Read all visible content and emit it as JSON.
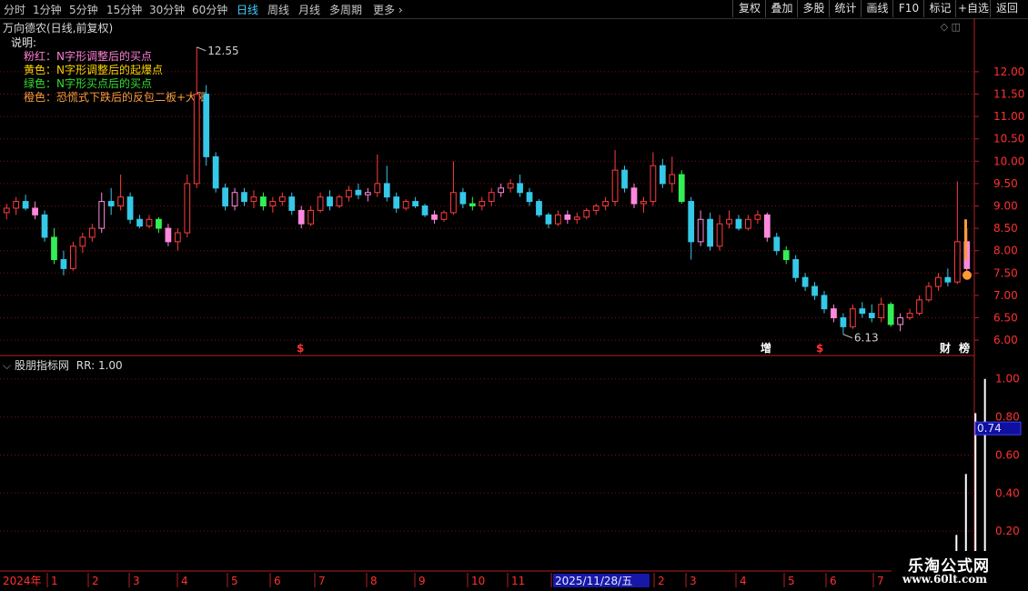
{
  "toolbar": {
    "periods": [
      "分时",
      "1分钟",
      "5分钟",
      "15分钟",
      "30分钟",
      "60分钟",
      "日线",
      "周线",
      "月线",
      "多周期",
      "更多"
    ],
    "active_period": "日线",
    "more_arrow": "›",
    "right_buttons": [
      "复权",
      "叠加",
      "多股",
      "统计",
      "画线",
      "F10",
      "标记",
      "+自选",
      "返回"
    ]
  },
  "stock": {
    "title": "万向德农(日线,前复权)"
  },
  "legend": {
    "title": "说明:",
    "lines": [
      {
        "text": "粉红：N字形调整后的买点",
        "color": "#ff7fd4"
      },
      {
        "text": "黄色：N字形调整后的起爆点",
        "color": "#ffd700"
      },
      {
        "text": "绿色：N字形买点后的买点",
        "color": "#33dd33"
      },
      {
        "text": "橙色：恐慌式下跌后的反包二板+大阳",
        "color": "#ffa040"
      }
    ]
  },
  "price_axis": {
    "ticks": [
      "12.00",
      "11.50",
      "11.00",
      "10.50",
      "10.00",
      "9.50",
      "9.00",
      "8.50",
      "8.00",
      "7.50",
      "7.00",
      "6.50",
      "6.00"
    ],
    "ymin": 5.88,
    "ymax": 12.75
  },
  "annotations": {
    "high": "12.55",
    "low": "6.13",
    "event_markers": [
      {
        "text": "$",
        "color": "#ff3333"
      },
      {
        "text": "增",
        "color": "#ffffff"
      },
      {
        "text": "$",
        "color": "#ff3333"
      },
      {
        "text": "财",
        "color": "#ffffff"
      },
      {
        "text": "榜",
        "color": "#ffffff"
      }
    ]
  },
  "indicator": {
    "name": "股朋指标网",
    "param": "RR: 1.00",
    "ticks": [
      "1.00",
      "0.80",
      "0.60",
      "0.40",
      "0.20"
    ],
    "current_value": "0.74",
    "ymin": 0.0,
    "ymax": 1.08
  },
  "time_axis": {
    "labels": [
      "2024年",
      "1",
      "2",
      "3",
      "4",
      "5",
      "6",
      "7",
      "8",
      "9",
      "10",
      "11",
      "2025/11/28/五",
      "2",
      "3",
      "4",
      "5",
      "6",
      "7"
    ],
    "highlight": "2025/11/28/五"
  },
  "watermark": {
    "line1": "乐淘公式网",
    "line2": "www.60lt.com"
  },
  "chart_data": {
    "type": "candlestick",
    "series": [
      {
        "values": [
          [
            8.85,
            9.05,
            8.7,
            8.95
          ],
          [
            8.95,
            9.2,
            8.8,
            9.1
          ],
          [
            9.1,
            9.25,
            8.9,
            8.95
          ],
          [
            8.95,
            9.1,
            8.7,
            8.8
          ],
          [
            8.8,
            8.9,
            8.2,
            8.3
          ],
          [
            8.3,
            8.5,
            7.7,
            7.8
          ],
          [
            7.8,
            8.0,
            7.45,
            7.6
          ],
          [
            7.6,
            8.2,
            7.55,
            8.1
          ],
          [
            8.1,
            8.4,
            7.95,
            8.3
          ],
          [
            8.3,
            8.6,
            8.2,
            8.5
          ],
          [
            8.5,
            9.3,
            8.4,
            9.1
          ],
          [
            9.1,
            9.4,
            8.8,
            9.0
          ],
          [
            9.0,
            9.7,
            8.9,
            9.2
          ],
          [
            9.2,
            9.3,
            8.6,
            8.7
          ],
          [
            8.7,
            8.8,
            8.5,
            8.55
          ],
          [
            8.55,
            8.8,
            8.5,
            8.7
          ],
          [
            8.7,
            8.75,
            8.4,
            8.5
          ],
          [
            8.5,
            8.6,
            8.1,
            8.2
          ],
          [
            8.2,
            8.5,
            8.0,
            8.4
          ],
          [
            8.4,
            9.7,
            8.3,
            9.5
          ],
          [
            9.5,
            12.55,
            9.4,
            11.5
          ],
          [
            11.5,
            11.7,
            9.9,
            10.1
          ],
          [
            10.1,
            10.2,
            9.3,
            9.4
          ],
          [
            9.4,
            9.5,
            8.9,
            9.0
          ],
          [
            9.0,
            9.4,
            8.9,
            9.3
          ],
          [
            9.3,
            9.4,
            9.0,
            9.1
          ],
          [
            9.1,
            9.35,
            8.95,
            9.2
          ],
          [
            9.2,
            9.3,
            8.9,
            9.0
          ],
          [
            9.0,
            9.2,
            8.85,
            9.1
          ],
          [
            9.1,
            9.3,
            9.0,
            9.2
          ],
          [
            9.2,
            9.3,
            8.8,
            8.9
          ],
          [
            8.9,
            9.0,
            8.5,
            8.6
          ],
          [
            8.6,
            9.0,
            8.55,
            8.9
          ],
          [
            8.9,
            9.3,
            8.85,
            9.2
          ],
          [
            9.2,
            9.35,
            8.9,
            9.0
          ],
          [
            9.0,
            9.25,
            8.95,
            9.2
          ],
          [
            9.2,
            9.45,
            9.1,
            9.35
          ],
          [
            9.35,
            9.5,
            9.15,
            9.25
          ],
          [
            9.25,
            9.4,
            9.1,
            9.3
          ],
          [
            9.3,
            10.15,
            9.2,
            9.5
          ],
          [
            9.5,
            9.9,
            9.1,
            9.2
          ],
          [
            9.2,
            9.3,
            8.85,
            8.95
          ],
          [
            8.95,
            9.15,
            8.9,
            9.1
          ],
          [
            9.1,
            9.2,
            8.95,
            9.0
          ],
          [
            9.0,
            9.05,
            8.75,
            8.8
          ],
          [
            8.8,
            8.9,
            8.6,
            8.7
          ],
          [
            8.7,
            8.9,
            8.65,
            8.85
          ],
          [
            8.85,
            10.0,
            8.8,
            9.3
          ],
          [
            9.3,
            9.4,
            8.95,
            9.05
          ],
          [
            9.05,
            9.2,
            8.9,
            9.0
          ],
          [
            9.0,
            9.2,
            8.9,
            9.1
          ],
          [
            9.1,
            9.4,
            9.0,
            9.3
          ],
          [
            9.3,
            9.5,
            9.2,
            9.4
          ],
          [
            9.4,
            9.6,
            9.3,
            9.5
          ],
          [
            9.5,
            9.7,
            9.2,
            9.3
          ],
          [
            9.3,
            9.4,
            9.0,
            9.1
          ],
          [
            9.1,
            9.15,
            8.75,
            8.8
          ],
          [
            8.8,
            8.85,
            8.5,
            8.6
          ],
          [
            8.6,
            8.9,
            8.55,
            8.8
          ],
          [
            8.8,
            8.9,
            8.6,
            8.7
          ],
          [
            8.7,
            8.85,
            8.6,
            8.75
          ],
          [
            8.75,
            8.95,
            8.7,
            8.9
          ],
          [
            8.9,
            9.05,
            8.8,
            9.0
          ],
          [
            9.0,
            9.2,
            8.9,
            9.1
          ],
          [
            9.1,
            10.25,
            9.0,
            9.8
          ],
          [
            9.8,
            9.9,
            9.3,
            9.4
          ],
          [
            9.4,
            9.5,
            8.95,
            9.05
          ],
          [
            9.05,
            9.2,
            8.85,
            9.1
          ],
          [
            9.1,
            10.2,
            9.0,
            9.9
          ],
          [
            9.9,
            10.05,
            9.4,
            9.5
          ],
          [
            9.5,
            10.1,
            9.3,
            9.7
          ],
          [
            9.7,
            9.8,
            9.05,
            9.1
          ],
          [
            9.1,
            9.2,
            7.8,
            8.2
          ],
          [
            8.2,
            8.9,
            8.1,
            8.7
          ],
          [
            8.7,
            8.85,
            8.0,
            8.1
          ],
          [
            8.1,
            8.8,
            8.0,
            8.6
          ],
          [
            8.6,
            8.9,
            8.5,
            8.7
          ],
          [
            8.7,
            8.8,
            8.45,
            8.5
          ],
          [
            8.5,
            8.8,
            8.45,
            8.7
          ],
          [
            8.7,
            8.9,
            8.6,
            8.8
          ],
          [
            8.8,
            8.85,
            8.2,
            8.3
          ],
          [
            8.3,
            8.4,
            7.9,
            8.0
          ],
          [
            8.0,
            8.1,
            7.7,
            7.8
          ],
          [
            7.8,
            7.9,
            7.3,
            7.4
          ],
          [
            7.4,
            7.5,
            7.1,
            7.2
          ],
          [
            7.2,
            7.3,
            6.9,
            7.0
          ],
          [
            7.0,
            7.1,
            6.6,
            6.7
          ],
          [
            6.7,
            6.8,
            6.4,
            6.5
          ],
          [
            6.5,
            6.6,
            6.13,
            6.3
          ],
          [
            6.3,
            6.8,
            6.25,
            6.7
          ],
          [
            6.7,
            6.85,
            6.5,
            6.6
          ],
          [
            6.6,
            6.8,
            6.4,
            6.5
          ],
          [
            6.5,
            6.95,
            6.4,
            6.8
          ],
          [
            6.8,
            6.85,
            6.3,
            6.35
          ],
          [
            6.35,
            6.6,
            6.2,
            6.5
          ],
          [
            6.5,
            6.7,
            6.45,
            6.6
          ],
          [
            6.6,
            7.0,
            6.55,
            6.9
          ],
          [
            6.9,
            7.3,
            6.85,
            7.2
          ],
          [
            7.2,
            7.5,
            7.1,
            7.4
          ],
          [
            7.4,
            7.6,
            7.2,
            7.3
          ],
          [
            7.3,
            9.55,
            7.25,
            8.2
          ],
          [
            8.2,
            8.5,
            7.5,
            7.6
          ]
        ]
      }
    ],
    "indicator_values": [
      0.0,
      0.0,
      0.0,
      0.0,
      0.0,
      0.0,
      0.0,
      0.0,
      0.0,
      0.0,
      0.0,
      0.0,
      0.0,
      0.0,
      0.0,
      0.0,
      0.0,
      0.0,
      0.0,
      0.0,
      0.0,
      0.0,
      0.0,
      0.0,
      0.0,
      0.0,
      0.0,
      0.0,
      0.0,
      0.0,
      0.0,
      0.0,
      0.0,
      0.0,
      0.0,
      0.0,
      0.0,
      0.0,
      0.0,
      0.0,
      0.0,
      0.0,
      0.0,
      0.0,
      0.0,
      0.0,
      0.0,
      0.0,
      0.0,
      0.0,
      0.0,
      0.0,
      0.0,
      0.0,
      0.0,
      0.0,
      0.0,
      0.0,
      0.0,
      0.0,
      0.0,
      0.0,
      0.0,
      0.0,
      0.0,
      0.0,
      0.0,
      0.0,
      0.0,
      0.0,
      0.0,
      0.0,
      0.0,
      0.0,
      0.0,
      0.0,
      0.0,
      0.0,
      0.0,
      0.0,
      0.0,
      0.0,
      0.0,
      0.0,
      0.0,
      0.0,
      0.0,
      0.0,
      0.0,
      0.0,
      0.0,
      0.0,
      0.0,
      0.0,
      0.0,
      0.0,
      0.0,
      0.0,
      0.0,
      0.0,
      0.18,
      0.5,
      0.82,
      1.0
    ],
    "colors": {
      "up": "#ff3c3c",
      "down": "#35c8e8",
      "grid": "#7a1010",
      "pink": "#ff88dd",
      "green": "#33ee55",
      "yellow": "#ffd700",
      "orange": "#ff9a30"
    }
  }
}
